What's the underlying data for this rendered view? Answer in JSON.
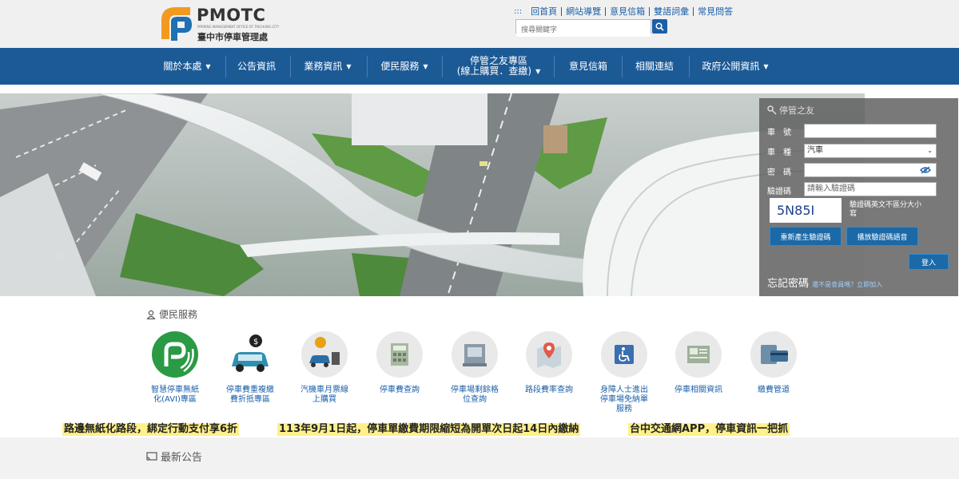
{
  "header": {
    "logo_title": "PMOTC",
    "logo_subtitle": "PARKING MANAGEMENT OFFICE OF TAICHUNG CITY",
    "logo_cn": "臺中市停車管理處",
    "top_links": [
      "回首頁",
      "網站導覽",
      "意見信箱",
      "雙語詞彙",
      "常見問答"
    ],
    "search_placeholder": "搜尋關鍵字"
  },
  "nav": {
    "items": [
      {
        "label": "關於本處",
        "caret": "▼"
      },
      {
        "label": "公告資訊",
        "caret": ""
      },
      {
        "label": "業務資訊",
        "caret": "▼"
      },
      {
        "label": "便民服務",
        "caret": "▼"
      },
      {
        "label": "停管之友專區(線上購買．查繳)",
        "line1": "停管之友專區",
        "line2": "(線上購買．查繳)",
        "caret": "▼"
      },
      {
        "label": "意見信箱",
        "caret": ""
      },
      {
        "label": "相關連結",
        "caret": ""
      },
      {
        "label": "政府公開資訊",
        "caret": "▼"
      }
    ]
  },
  "login": {
    "title": "停管之友",
    "plate_label": "車　號",
    "vehicle_label": "車　種",
    "vehicle_value": "汽車",
    "password_label": "密　碼",
    "captcha_label": "驗證碼",
    "captcha_placeholder": "請輸入驗證碼",
    "captcha_code": "5N85I",
    "captcha_hint": "驗證碼英文不區分大小寫",
    "regen_button": "重新產生驗證碼",
    "audio_button": "播放驗證碼語音",
    "login_button": "登入",
    "forgot_label": "忘記密碼",
    "forgot_note": "還不是會員嗎？立即加入"
  },
  "services": {
    "title": "便民服務",
    "items": [
      {
        "label": "智慧停車無紙化(AVI)專區",
        "line1": "智慧停車無紙",
        "line2": "化(AVI)專區"
      },
      {
        "label": "停車費重複繳費折抵專區",
        "line1": "停車費重複繳",
        "line2": "費折抵專區"
      },
      {
        "label": "汽機車月票線上購買",
        "line1": "汽機車月票線",
        "line2": "上購買"
      },
      {
        "label": "停車費查詢",
        "line1": "停車費查詢",
        "line2": ""
      },
      {
        "label": "停車場剩餘格位查詢",
        "line1": "停車場剩餘格",
        "line2": "位查詢"
      },
      {
        "label": "路段費率查詢",
        "line1": "路段費率查詢",
        "line2": ""
      },
      {
        "label": "身障人士進出停車場免納單服務",
        "line1": "身障人士進出",
        "line2": "停車場免納單",
        "line3": "服務"
      },
      {
        "label": "停車相關資訊",
        "line1": "停車相關資訊",
        "line2": ""
      },
      {
        "label": "繳費管道",
        "line1": "繳費管道",
        "line2": ""
      }
    ]
  },
  "marquee": [
    "路邊無紙化路段，綁定行動支付享6折",
    "113年9月1日起，停車單繳費期限縮短為開單次日起14日內繳納",
    "台中交通網APP，停車資訊一把抓"
  ],
  "news": {
    "title": "最新公告"
  },
  "colors": {
    "nav_bg": "#1c5a96",
    "link": "#1b5fa8",
    "highlight": "#fff08a",
    "avi_green": "#2a9a44"
  }
}
